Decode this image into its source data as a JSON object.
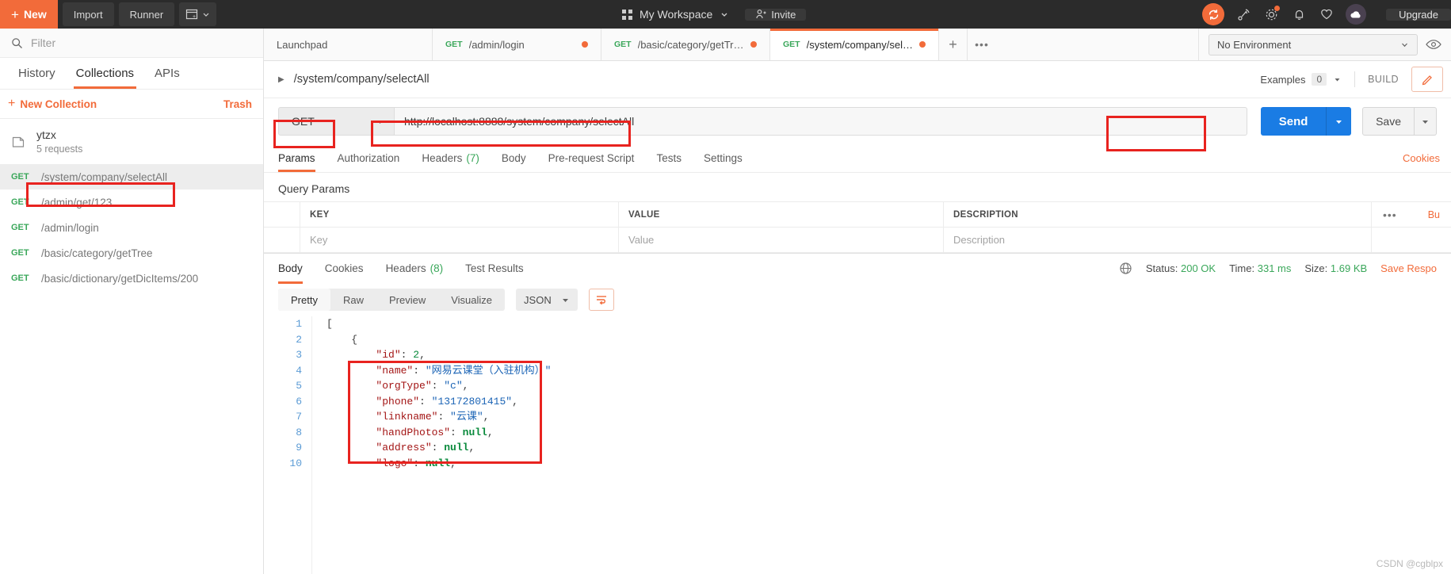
{
  "topbar": {
    "new_label": "New",
    "import_label": "Import",
    "runner_label": "Runner",
    "workspace_label": "My Workspace",
    "invite_label": "Invite",
    "upgrade_label": "Upgrade"
  },
  "sidebar": {
    "filter_placeholder": "Filter",
    "tabs": [
      {
        "label": "History",
        "active": false
      },
      {
        "label": "Collections",
        "active": true
      },
      {
        "label": "APIs",
        "active": false
      }
    ],
    "new_collection_label": "New Collection",
    "trash_label": "Trash",
    "collection": {
      "name": "ytzx",
      "requests_label": "5 requests"
    },
    "requests": [
      {
        "method": "GET",
        "name": "/system/company/selectAll",
        "selected": true
      },
      {
        "method": "GET",
        "name": "/admin/get/123",
        "selected": false
      },
      {
        "method": "GET",
        "name": "/admin/login",
        "selected": false
      },
      {
        "method": "GET",
        "name": "/basic/category/getTree",
        "selected": false
      },
      {
        "method": "GET",
        "name": "/basic/dictionary/getDicItems/200",
        "selected": false
      }
    ]
  },
  "tabstrip": {
    "tabs": [
      {
        "method": "",
        "name": "Launchpad",
        "dirty": false,
        "active": false
      },
      {
        "method": "GET",
        "name": "/admin/login",
        "dirty": true,
        "active": false
      },
      {
        "method": "GET",
        "name": "/basic/category/getTree",
        "dirty": true,
        "active": false
      },
      {
        "method": "GET",
        "name": "/system/company/selectAll",
        "dirty": true,
        "active": true
      }
    ],
    "add_label": "+",
    "more_label": "000",
    "environment": "No Environment"
  },
  "request_header": {
    "title": "/system/company/selectAll",
    "examples_label": "Examples",
    "examples_count": "0",
    "build_label": "BUILD"
  },
  "url_bar": {
    "method": "GET",
    "url": "http://localhost:8888/system/company/selectAll",
    "send_label": "Send",
    "save_label": "Save"
  },
  "request_tabs": {
    "tabs": [
      {
        "label": "Params",
        "count": "",
        "active": true
      },
      {
        "label": "Authorization",
        "count": "",
        "active": false
      },
      {
        "label": "Headers",
        "count": "(7)",
        "active": false
      },
      {
        "label": "Body",
        "count": "",
        "active": false
      },
      {
        "label": "Pre-request Script",
        "count": "",
        "active": false
      },
      {
        "label": "Tests",
        "count": "",
        "active": false
      },
      {
        "label": "Settings",
        "count": "",
        "active": false
      }
    ],
    "cookies_label": "Cookies"
  },
  "query_params": {
    "title": "Query Params",
    "columns": [
      "KEY",
      "VALUE",
      "DESCRIPTION"
    ],
    "placeholder_row": [
      "Key",
      "Value",
      "Description"
    ],
    "bulk_label": "Bu",
    "dots_label": "•••"
  },
  "response": {
    "tabs": [
      {
        "label": "Body",
        "count": "",
        "active": true
      },
      {
        "label": "Cookies",
        "count": "",
        "active": false
      },
      {
        "label": "Headers",
        "count": "(8)",
        "active": false
      },
      {
        "label": "Test Results",
        "count": "",
        "active": false
      }
    ],
    "status_label": "Status:",
    "status_value": "200 OK",
    "time_label": "Time:",
    "time_value": "331 ms",
    "size_label": "Size:",
    "size_value": "1.69 KB",
    "save_response_label": "Save Respo"
  },
  "viewer": {
    "segments": [
      {
        "label": "Pretty",
        "active": true
      },
      {
        "label": "Raw",
        "active": false
      },
      {
        "label": "Preview",
        "active": false
      },
      {
        "label": "Visualize",
        "active": false
      }
    ],
    "format": "JSON"
  },
  "code": {
    "lines": [
      {
        "n": "1",
        "tokens": [
          {
            "t": "[",
            "c": "tk-punc"
          }
        ]
      },
      {
        "n": "2",
        "tokens": [
          {
            "t": "    {",
            "c": "tk-punc"
          }
        ]
      },
      {
        "n": "3",
        "tokens": [
          {
            "t": "        ",
            "c": "tk-punc"
          },
          {
            "t": "\"id\"",
            "c": "tk-key"
          },
          {
            "t": ": ",
            "c": "tk-punc"
          },
          {
            "t": "2",
            "c": "tk-num"
          },
          {
            "t": ",",
            "c": "tk-punc"
          }
        ]
      },
      {
        "n": "4",
        "tokens": [
          {
            "t": "        ",
            "c": "tk-punc"
          },
          {
            "t": "\"name\"",
            "c": "tk-key"
          },
          {
            "t": ": ",
            "c": "tk-punc"
          },
          {
            "t": "\"网易云课堂（入驻机构）\"",
            "c": "tk-str"
          }
        ]
      },
      {
        "n": "5",
        "tokens": [
          {
            "t": "        ",
            "c": "tk-punc"
          },
          {
            "t": "\"orgType\"",
            "c": "tk-key"
          },
          {
            "t": ": ",
            "c": "tk-punc"
          },
          {
            "t": "\"c\"",
            "c": "tk-str"
          },
          {
            "t": ",",
            "c": "tk-punc"
          }
        ]
      },
      {
        "n": "6",
        "tokens": [
          {
            "t": "        ",
            "c": "tk-punc"
          },
          {
            "t": "\"phone\"",
            "c": "tk-key"
          },
          {
            "t": ": ",
            "c": "tk-punc"
          },
          {
            "t": "\"13172801415\"",
            "c": "tk-str"
          },
          {
            "t": ",",
            "c": "tk-punc"
          }
        ]
      },
      {
        "n": "7",
        "tokens": [
          {
            "t": "        ",
            "c": "tk-punc"
          },
          {
            "t": "\"linkname\"",
            "c": "tk-key"
          },
          {
            "t": ": ",
            "c": "tk-punc"
          },
          {
            "t": "\"云课\"",
            "c": "tk-str"
          },
          {
            "t": ",",
            "c": "tk-punc"
          }
        ]
      },
      {
        "n": "8",
        "tokens": [
          {
            "t": "        ",
            "c": "tk-punc"
          },
          {
            "t": "\"handPhotos\"",
            "c": "tk-key"
          },
          {
            "t": ": ",
            "c": "tk-punc"
          },
          {
            "t": "null",
            "c": "tk-null"
          },
          {
            "t": ",",
            "c": "tk-punc"
          }
        ]
      },
      {
        "n": "9",
        "tokens": [
          {
            "t": "        ",
            "c": "tk-punc"
          },
          {
            "t": "\"address\"",
            "c": "tk-key"
          },
          {
            "t": ": ",
            "c": "tk-punc"
          },
          {
            "t": "null",
            "c": "tk-null"
          },
          {
            "t": ",",
            "c": "tk-punc"
          }
        ]
      },
      {
        "n": "10",
        "tokens": [
          {
            "t": "        ",
            "c": "tk-punc"
          },
          {
            "t": "\"logo\"",
            "c": "tk-key"
          },
          {
            "t": ": ",
            "c": "tk-punc"
          },
          {
            "t": "null",
            "c": "tk-null"
          },
          {
            "t": ",",
            "c": "tk-punc"
          }
        ]
      }
    ]
  },
  "watermark": "CSDN @cgblpx",
  "colors": {
    "brand_orange": "#f26b3a",
    "send_blue": "#1a7ce4",
    "method_green": "#3aa75a",
    "annotation_red": "#e8231f"
  }
}
